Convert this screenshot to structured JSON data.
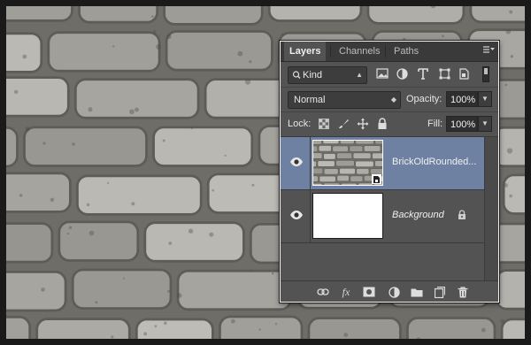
{
  "panel": {
    "tabs": [
      {
        "label": "Layers",
        "active": true
      },
      {
        "label": "Channels",
        "active": false
      },
      {
        "label": "Paths",
        "active": false
      }
    ],
    "filter": {
      "kind_label": "Kind"
    },
    "blend": {
      "mode": "Normal",
      "opacity_label": "Opacity:",
      "opacity_value": "100%"
    },
    "lock": {
      "label": "Lock:",
      "fill_label": "Fill:",
      "fill_value": "100%"
    },
    "layers": [
      {
        "name": "BrickOldRounded...",
        "selected": true,
        "visible": true,
        "thumbnail": "brick-texture"
      },
      {
        "name": "Background",
        "selected": false,
        "visible": true,
        "thumbnail": "white",
        "locked": true
      }
    ],
    "footer_icons": [
      "link-icon",
      "fx-icon",
      "mask-icon",
      "adjustment-icon",
      "folder-icon",
      "new-layer-icon",
      "trash-icon"
    ]
  },
  "colors": {
    "panel_bg": "#535353",
    "selected_layer": "#6f81a2",
    "border_highlight": "#f2f2f2"
  }
}
